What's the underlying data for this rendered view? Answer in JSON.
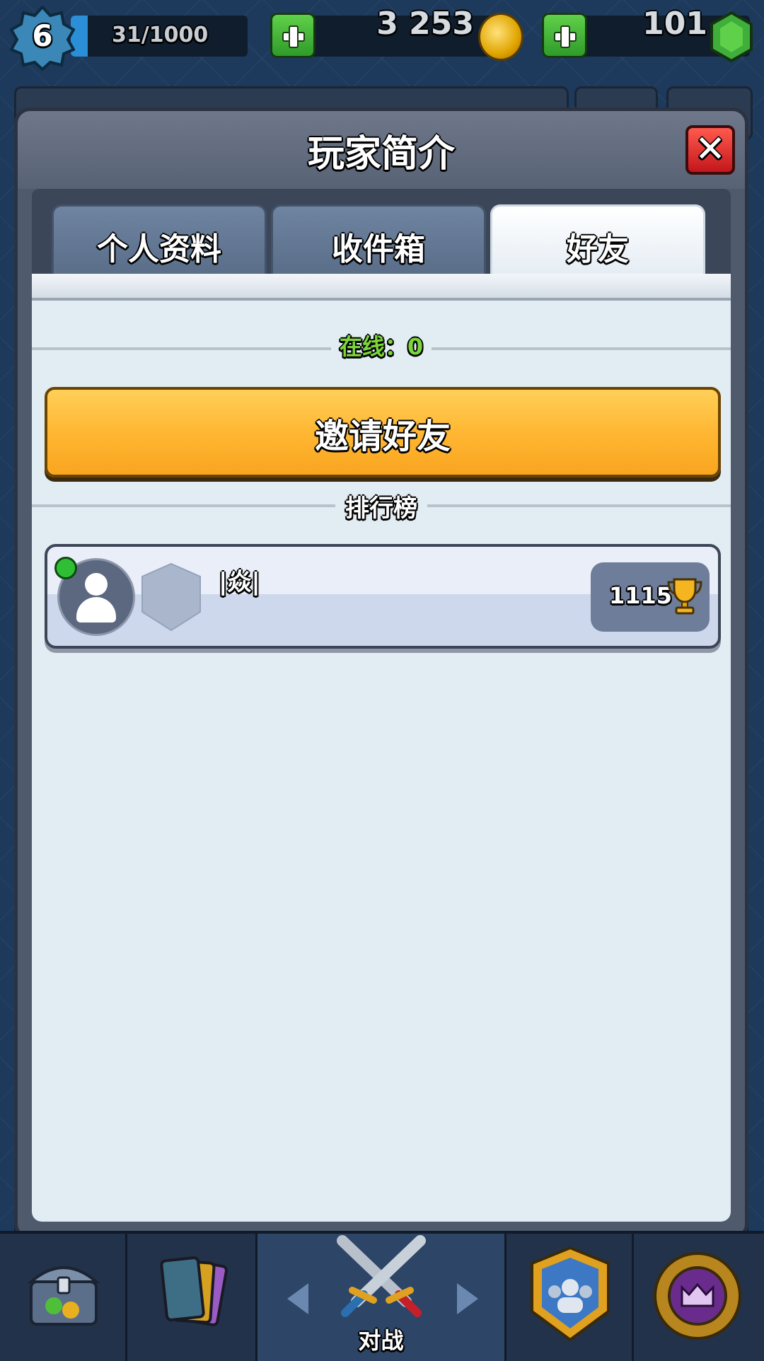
{
  "top_bar": {
    "level": "6",
    "xp": "31/1000",
    "gold": "3 253",
    "gems": "101"
  },
  "modal": {
    "title": "玩家简介",
    "close_icon": "close-x-icon",
    "tabs": [
      {
        "label": "个人资料",
        "active": false
      },
      {
        "label": "收件箱",
        "active": false
      },
      {
        "label": "好友",
        "active": true
      }
    ]
  },
  "friends_tab": {
    "online_label": "在线：0",
    "invite_button": "邀请好友",
    "leaderboard_label": "排行榜",
    "entries": [
      {
        "name": "|焱|",
        "trophies": "1115",
        "online": true
      }
    ]
  },
  "bottom_nav": {
    "battle_label": "对战"
  },
  "colors": {
    "online_text": "#7cd63a",
    "invite_button": "#ffb733",
    "close_button": "#e0222a",
    "plus_button": "#3fae34"
  }
}
